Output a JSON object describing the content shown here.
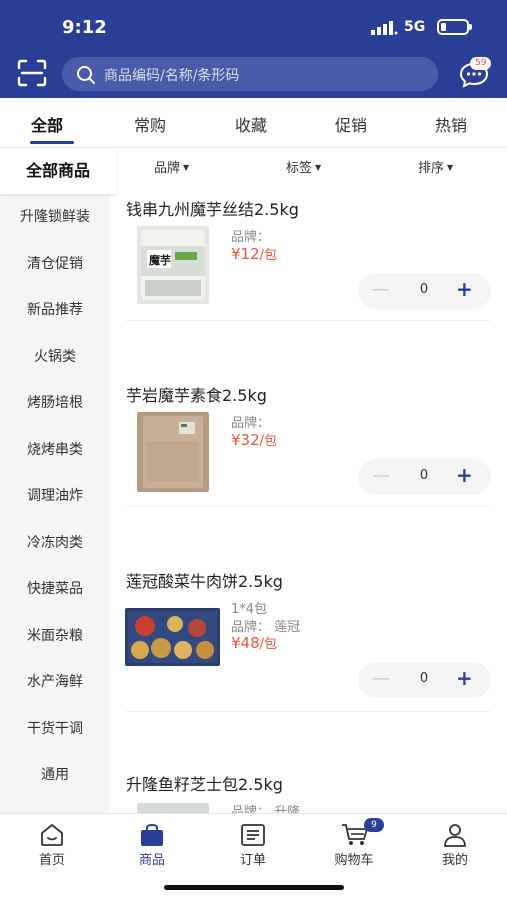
{
  "status": {
    "time": "9:12",
    "network": "5G"
  },
  "header": {
    "search_placeholder": "商品编码/名称/条形码",
    "message_badge": "59"
  },
  "tabs": [
    {
      "label": "全部",
      "active": true
    },
    {
      "label": "常购"
    },
    {
      "label": "收藏"
    },
    {
      "label": "促销"
    },
    {
      "label": "热销"
    }
  ],
  "sidebar": {
    "items": [
      {
        "label": "全部商品",
        "active": true
      },
      {
        "label": "升隆锁鲜装"
      },
      {
        "label": "清仓促销"
      },
      {
        "label": "新品推荐"
      },
      {
        "label": "火锅类"
      },
      {
        "label": "烤肠培根"
      },
      {
        "label": "烧烤串类"
      },
      {
        "label": "调理油炸"
      },
      {
        "label": "冷冻肉类"
      },
      {
        "label": "快捷菜品"
      },
      {
        "label": "米面杂粮"
      },
      {
        "label": "水产海鲜"
      },
      {
        "label": "干货干调"
      },
      {
        "label": "通用"
      }
    ]
  },
  "filters": {
    "brand": "品牌",
    "tag": "标签",
    "sort": "排序"
  },
  "products": [
    {
      "name": "钱串九州魔芋丝结2.5kg",
      "spec": "",
      "brand": "品牌：",
      "price": "¥12",
      "unit": "/包",
      "qty": "0",
      "thumb_text": "魔芋"
    },
    {
      "name": "芋岩魔芋素食2.5kg",
      "spec": "",
      "brand": "品牌：",
      "price": "¥32",
      "unit": "/包",
      "qty": "0",
      "thumb_text": ""
    },
    {
      "name": "莲冠酸菜牛肉饼2.5kg",
      "spec": "1*4包",
      "brand": "品牌： 莲冠",
      "price": "¥48",
      "unit": "/包",
      "qty": "0",
      "thumb_text": ""
    },
    {
      "name": "升隆鱼籽芝士包2.5kg",
      "spec": "",
      "brand": "品牌： 升隆",
      "price": "",
      "unit": "",
      "qty": "",
      "thumb_text": ""
    }
  ],
  "stepper_symbols": {
    "minus": "—",
    "plus": "+"
  },
  "bottom_nav": [
    {
      "label": "首页",
      "icon": "home-icon"
    },
    {
      "label": "商品",
      "icon": "bag-icon",
      "active": true
    },
    {
      "label": "订单",
      "icon": "order-icon"
    },
    {
      "label": "购物车",
      "icon": "cart-icon",
      "badge": "9"
    },
    {
      "label": "我的",
      "icon": "user-icon"
    }
  ],
  "colors": {
    "primary": "#2b3f97",
    "price": "#e8573b",
    "sidebar_bg": "#f5f5f5"
  }
}
